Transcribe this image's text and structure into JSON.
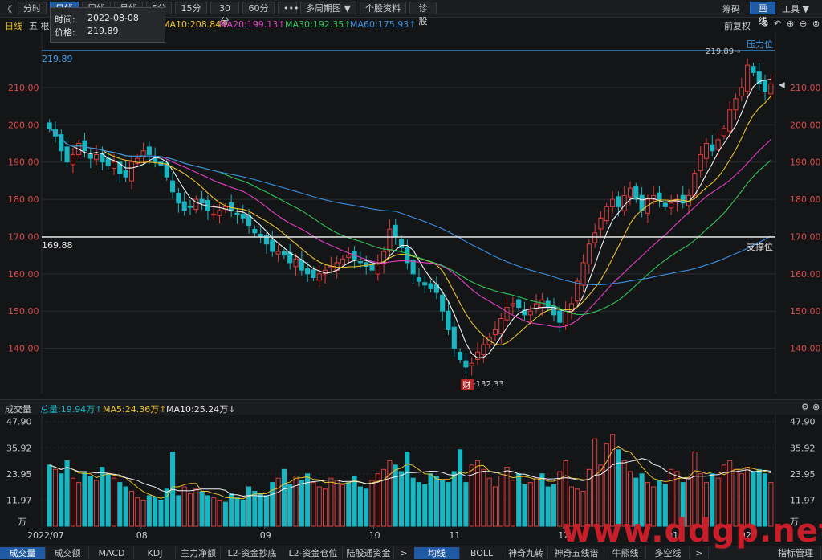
{
  "top_bar": {
    "back": "《",
    "tabs": [
      {
        "label": "分时",
        "active": false
      },
      {
        "label": "日线",
        "active": true
      },
      {
        "label": "周线",
        "active": false
      },
      {
        "label": "月线",
        "active": false
      },
      {
        "label": "5分",
        "active": false
      },
      {
        "label": "15分",
        "active": false
      },
      {
        "label": "30分",
        "active": false
      },
      {
        "label": "60分",
        "active": false
      },
      {
        "label": "•••",
        "active": false
      },
      {
        "label": "多周期图 ▼",
        "active": false
      },
      {
        "label": "个股资料",
        "active": false
      },
      {
        "label": "诊股",
        "active": false
      }
    ],
    "right": {
      "chips": "筹码",
      "draw": "画线",
      "tools": "工具 ▼"
    }
  },
  "tooltip": {
    "time_label": "时间:",
    "time_value": "2022-08-08",
    "price_label": "价格:",
    "price_value": "219.89"
  },
  "ma_legend": {
    "period": "日线",
    "prefix": "五 根",
    "ma10": "MA10:208.84↑",
    "ma20": "MA20:199.13↑",
    "ma30": "MA30:192.35↑",
    "ma60": "MA60:175.93↑",
    "adjust": "前复权"
  },
  "price_lines": {
    "top_label": "219.89",
    "top_value": 219.89,
    "support_value": 169.88,
    "support_label": "169.88",
    "support_text": "支撑位",
    "resistance_text": "压力位",
    "low_label": "←132.33",
    "high_label": "219.89→",
    "event_badge": "财",
    "current_marker": "◀"
  },
  "colors": {
    "up": "#e03c3c",
    "down": "#19b6c2",
    "ma5": "#f2f2f2",
    "ma10": "#e8c22a",
    "ma20": "#e040c0",
    "ma30": "#2fc45a",
    "ma60": "#3a8fe0",
    "level_blue": "#3aa0f0",
    "level_white": "#e6e6e6"
  },
  "volume": {
    "title": "成交量",
    "total": "总量:19.94万↑",
    "ma5": "MA5:24.36万↑",
    "ma10": "MA10:25.24万↓",
    "unit": "万"
  },
  "bottom_tabs": [
    "成交量",
    "成交额",
    "MACD",
    "KDJ",
    "主力净额",
    "L2-资金抄底",
    "L2-资金仓位",
    "陆股通资金",
    ">",
    "均线",
    "BOLL",
    "神奇九转",
    "神奇五线谱",
    "牛熊线",
    "多空线",
    ">",
    "指标管理"
  ],
  "watermark": "www.ddgp.net",
  "chart_data": [
    {
      "type": "candlestick",
      "ylim": [
        130,
        224
      ],
      "y_ticks": [
        140,
        150,
        160,
        170,
        180,
        190,
        200,
        210
      ],
      "y_tick_labels": [
        "140.00",
        "150.00",
        "160.00",
        "170.00",
        "180.00",
        "190.00",
        "200.00",
        "210.00"
      ],
      "x_tick_labels": [
        "2022/07",
        "08",
        "09",
        "10",
        "11",
        "12",
        "01",
        "02"
      ],
      "close": [
        199,
        197,
        193,
        190,
        192,
        195,
        193,
        191,
        192,
        190,
        189,
        190,
        187,
        186,
        190,
        191,
        193,
        192,
        190,
        189,
        186,
        182,
        179,
        177,
        178,
        180,
        179,
        177,
        176,
        177,
        178,
        177,
        176,
        175,
        173,
        171,
        170,
        168,
        166,
        166,
        165,
        163,
        164,
        161,
        160,
        159,
        160,
        161,
        162,
        163,
        164,
        165,
        164,
        163,
        162,
        161,
        163,
        166,
        172,
        170,
        167,
        163,
        160,
        158,
        157,
        156,
        155,
        150,
        145,
        140,
        137,
        135,
        136,
        139,
        141,
        143,
        145,
        148,
        151,
        152,
        151,
        149,
        150,
        152,
        153,
        151,
        149,
        147,
        150,
        152,
        158,
        163,
        168,
        171,
        175,
        178,
        180,
        178,
        181,
        183,
        180,
        177,
        180,
        181,
        180,
        178,
        179,
        180,
        179,
        181,
        187,
        192,
        195,
        193,
        196,
        199,
        204,
        207,
        210,
        216,
        214,
        211,
        209,
        211
      ],
      "ma_series": [
        "MA5",
        "MA10",
        "MA20",
        "MA30",
        "MA60"
      ]
    },
    {
      "type": "bar",
      "title": "成交量",
      "ylim": [
        0,
        50
      ],
      "y_ticks": [
        11.97,
        23.95,
        35.92,
        47.9
      ],
      "y_tick_labels": [
        "11.97",
        "23.95",
        "35.92",
        "47.90"
      ],
      "values": [
        28,
        26,
        24,
        30,
        22,
        20,
        25,
        23,
        21,
        27,
        24,
        22,
        20,
        18,
        16,
        13,
        12,
        14,
        13,
        12,
        17,
        34,
        14,
        18,
        15,
        17,
        16,
        14,
        13,
        12,
        11,
        15,
        13,
        12,
        18,
        16,
        15,
        14,
        20,
        22,
        26,
        19,
        23,
        21,
        24,
        20,
        18,
        17,
        22,
        21,
        19,
        20,
        23,
        18,
        17,
        21,
        24,
        26,
        30,
        28,
        25,
        34,
        22,
        20,
        19,
        24,
        23,
        21,
        20,
        25,
        35,
        20,
        28,
        30,
        26,
        22,
        18,
        23,
        27,
        21,
        24,
        19,
        20,
        22,
        24,
        18,
        19,
        25,
        30,
        18,
        17,
        16,
        26,
        40,
        28,
        38,
        42,
        35,
        30,
        25,
        22,
        24,
        20,
        18,
        21,
        19,
        26,
        25,
        20,
        22,
        34,
        24,
        20,
        24,
        22,
        28,
        30,
        26,
        24,
        27,
        25,
        26,
        24,
        20
      ],
      "up_flags": [
        0,
        1,
        0,
        0,
        1,
        1,
        0,
        0,
        1,
        0,
        0,
        1,
        0,
        0,
        1,
        1,
        1,
        0,
        0,
        0,
        0,
        0,
        0,
        1,
        1,
        1,
        0,
        0,
        1,
        1,
        0,
        0,
        0,
        0,
        0,
        0,
        0,
        0,
        0,
        1,
        0,
        0,
        1,
        0,
        0,
        1,
        1,
        1,
        1,
        1,
        1,
        0,
        0,
        0,
        0,
        1,
        1,
        1,
        1,
        0,
        0,
        0,
        0,
        0,
        0,
        0,
        0,
        0,
        0,
        0,
        0,
        0,
        1,
        1,
        1,
        1,
        1,
        1,
        1,
        1,
        0,
        0,
        1,
        1,
        0,
        0,
        0,
        1,
        1,
        1,
        1,
        1,
        1,
        1,
        1,
        1,
        1,
        0,
        1,
        1,
        0,
        0,
        1,
        1,
        0,
        0,
        1,
        1,
        0,
        1,
        1,
        1,
        1,
        0,
        1,
        1,
        1,
        1,
        1,
        1,
        0,
        0,
        0,
        1
      ]
    }
  ]
}
